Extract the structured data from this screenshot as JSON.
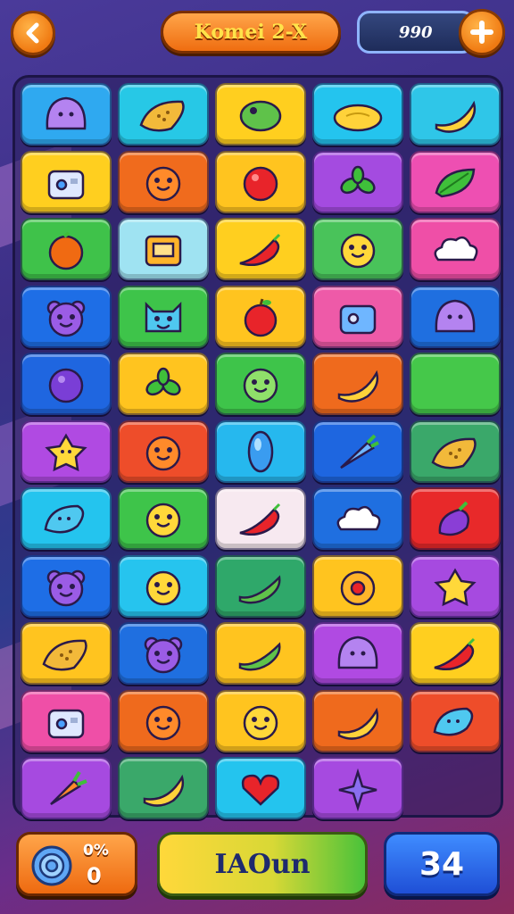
{
  "header": {
    "title": "Komei 2-X",
    "coins": "990",
    "back_icon": "chevron-left-icon",
    "plus_icon": "plus-icon"
  },
  "board": {
    "rows": [
      [
        {
          "color": "#2fa9f0",
          "icon": "blob-purple"
        },
        {
          "color": "#27c8e6",
          "icon": "bread"
        },
        {
          "color": "#ffcf1f",
          "icon": "frog"
        },
        {
          "color": "#24c4ee",
          "icon": "lemon"
        },
        {
          "color": "#2fc6e8",
          "icon": "banana"
        }
      ],
      [
        {
          "color": "#ffcf1f",
          "icon": "robot"
        },
        {
          "color": "#f06b1d",
          "icon": "face-orange"
        },
        {
          "color": "#ffc41f",
          "icon": "ball-red"
        },
        {
          "color": "#a44be0",
          "icon": "leaves"
        },
        {
          "color": "#ee4fb2",
          "icon": "leaf-green"
        }
      ],
      [
        {
          "color": "#3fc24a",
          "icon": "orange"
        },
        {
          "color": "#9fe3f2",
          "icon": "robot-yellow"
        },
        {
          "color": "#ffcf1f",
          "icon": "chili"
        },
        {
          "color": "#49c35a",
          "icon": "face-yellow"
        },
        {
          "color": "#ef4fa7",
          "icon": "cloud"
        }
      ],
      [
        {
          "color": "#1e6ee6",
          "icon": "bear-purple"
        },
        {
          "color": "#3ec44a",
          "icon": "cat-blue"
        },
        {
          "color": "#ffc41f",
          "icon": "apple"
        },
        {
          "color": "#ee5aa8",
          "icon": "robot-blue"
        },
        {
          "color": "#1f6fe0",
          "icon": "blob-purple2"
        }
      ],
      [
        {
          "color": "#1f66e0",
          "icon": "plum"
        },
        {
          "color": "#ffc41f",
          "icon": "leaves2"
        },
        {
          "color": "#3ec44a",
          "icon": "face-green"
        },
        {
          "color": "#ef6a1d",
          "icon": "banana2"
        },
        {
          "color": "#45c84a",
          "icon": "empty"
        }
      ],
      [
        {
          "color": "#b04ae2",
          "icon": "star-face"
        },
        {
          "color": "#ee4d2a",
          "icon": "face-orange2"
        },
        {
          "color": "#26b8ee",
          "icon": "gem-blue"
        },
        {
          "color": "#1e66e0",
          "icon": "carrot-blue"
        },
        {
          "color": "#3aa86a",
          "icon": "bread2"
        }
      ],
      [
        {
          "color": "#24c4ee",
          "icon": "leaf-blue"
        },
        {
          "color": "#3ec44a",
          "icon": "face-yellow2"
        },
        {
          "color": "#f7e9f0",
          "icon": "chili2"
        },
        {
          "color": "#1f6fe0",
          "icon": "cloud2"
        },
        {
          "color": "#e8292a",
          "icon": "eggplant"
        }
      ],
      [
        {
          "color": "#1e6ee6",
          "icon": "bear-purple2"
        },
        {
          "color": "#26c4ee",
          "icon": "face-yellow3"
        },
        {
          "color": "#2fa86a",
          "icon": "pea"
        },
        {
          "color": "#ffc41f",
          "icon": "donut"
        },
        {
          "color": "#a64ae0",
          "icon": "star-yellow"
        }
      ],
      [
        {
          "color": "#ffc41f",
          "icon": "bread3"
        },
        {
          "color": "#1f6fe0",
          "icon": "bear-purple3"
        },
        {
          "color": "#ffc41f",
          "icon": "pea2"
        },
        {
          "color": "#b04ae2",
          "icon": "blob-purple3"
        },
        {
          "color": "#ffcf1f",
          "icon": "chili3"
        }
      ],
      [
        {
          "color": "#ef4fa7",
          "icon": "robot2"
        },
        {
          "color": "#ef6a1d",
          "icon": "face-orange3"
        },
        {
          "color": "#ffc41f",
          "icon": "face-yellow4"
        },
        {
          "color": "#ef6a1d",
          "icon": "banana3"
        },
        {
          "color": "#ee4d2a",
          "icon": "leaf-blue2"
        }
      ],
      [
        {
          "color": "#a64ae0",
          "icon": "carrot"
        },
        {
          "color": "#3aa86a",
          "icon": "banana4"
        },
        {
          "color": "#24c4ee",
          "icon": "heart"
        },
        {
          "color": "#a64ae0",
          "icon": "sparkle"
        }
      ]
    ]
  },
  "footer": {
    "moves_pct": "0%",
    "moves_value": "0",
    "moves_icon": "swirl-icon",
    "action_label": "IAOun",
    "score": "34"
  }
}
